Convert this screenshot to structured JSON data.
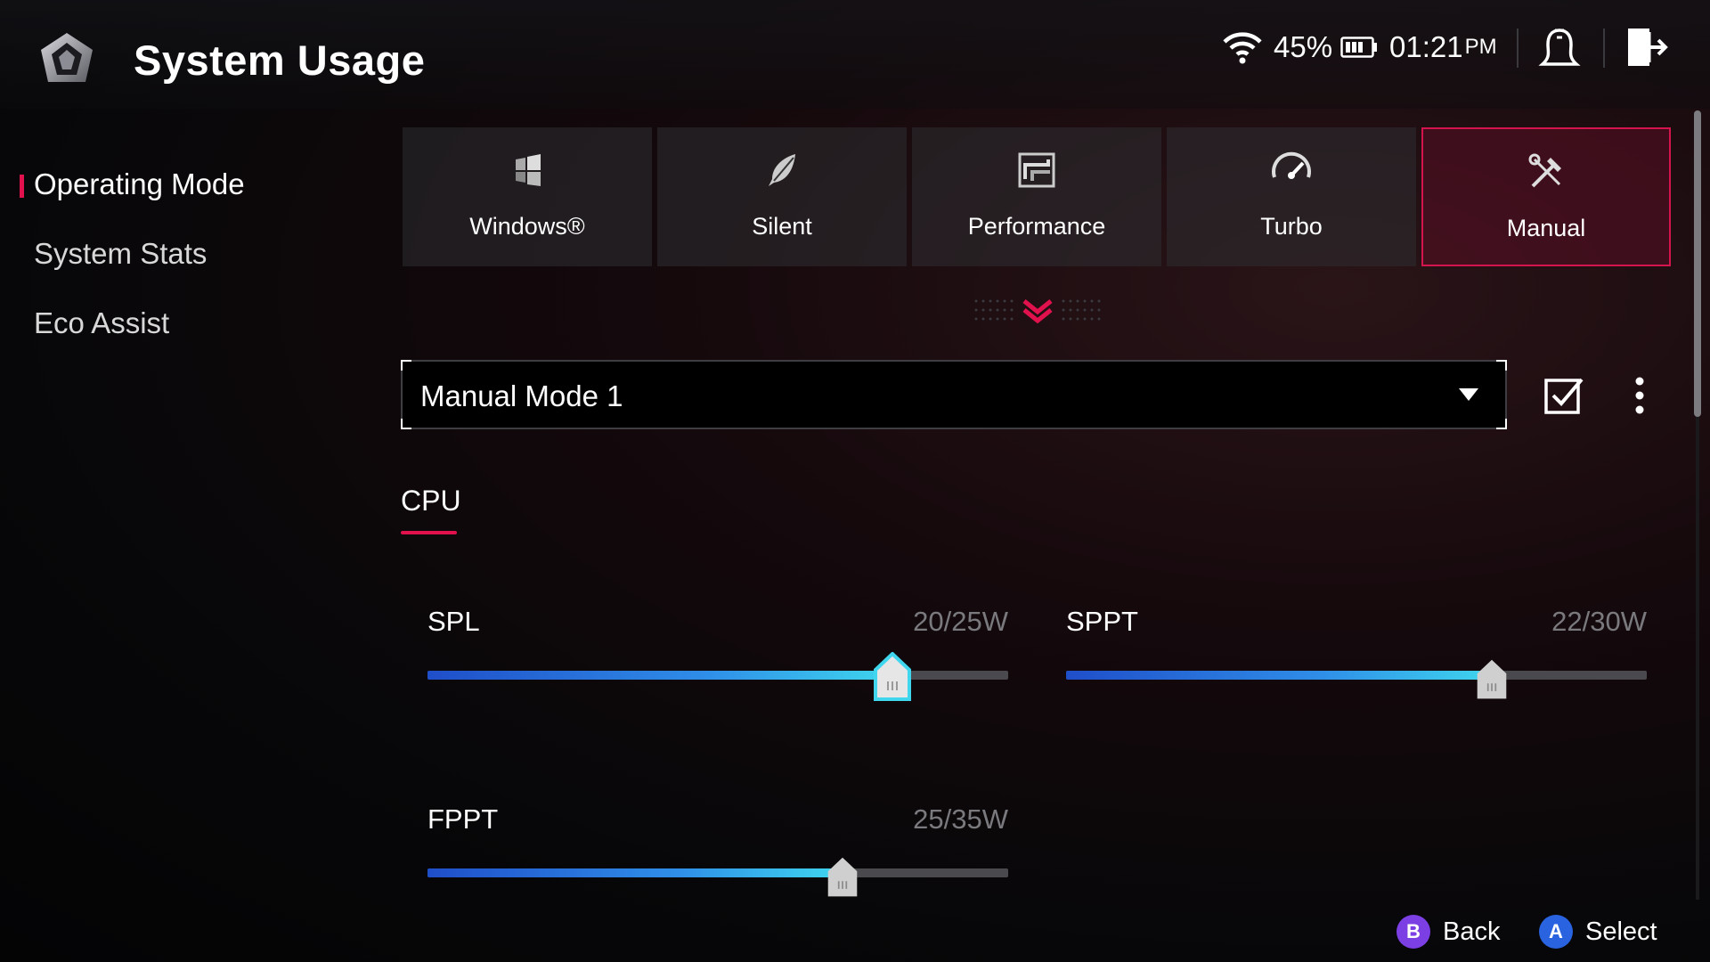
{
  "header": {
    "title": "System Usage"
  },
  "status": {
    "battery_percent": "45%",
    "time": "01:21",
    "ampm": "PM"
  },
  "sidebar": {
    "items": [
      {
        "label": "Operating Mode",
        "active": true
      },
      {
        "label": "System Stats",
        "active": false
      },
      {
        "label": "Eco Assist",
        "active": false
      }
    ]
  },
  "modes": [
    {
      "label": "Windows®",
      "icon": "windows-icon",
      "selected": false
    },
    {
      "label": "Silent",
      "icon": "leaf-icon",
      "selected": false
    },
    {
      "label": "Performance",
      "icon": "performance-icon",
      "selected": false
    },
    {
      "label": "Turbo",
      "icon": "turbo-gauge-icon",
      "selected": false
    },
    {
      "label": "Manual",
      "icon": "tools-icon",
      "selected": true
    }
  ],
  "profile_select": {
    "value": "Manual Mode 1"
  },
  "section": {
    "tab": "CPU"
  },
  "sliders": {
    "spl": {
      "label": "SPL",
      "value_text": "20/25W",
      "value": 20,
      "max": 25
    },
    "sppt": {
      "label": "SPPT",
      "value_text": "22/30W",
      "value": 22,
      "max": 30
    },
    "fppt": {
      "label": "FPPT",
      "value_text": "25/35W",
      "value": 25,
      "max": 35
    }
  },
  "hints": {
    "back": {
      "key": "B",
      "label": "Back"
    },
    "select": {
      "key": "A",
      "label": "Select"
    }
  },
  "colors": {
    "accent": "#e0114d",
    "slider_fill_end": "#3fd6ee",
    "button_b": "#7b3fe4",
    "button_a": "#2a63e0"
  }
}
